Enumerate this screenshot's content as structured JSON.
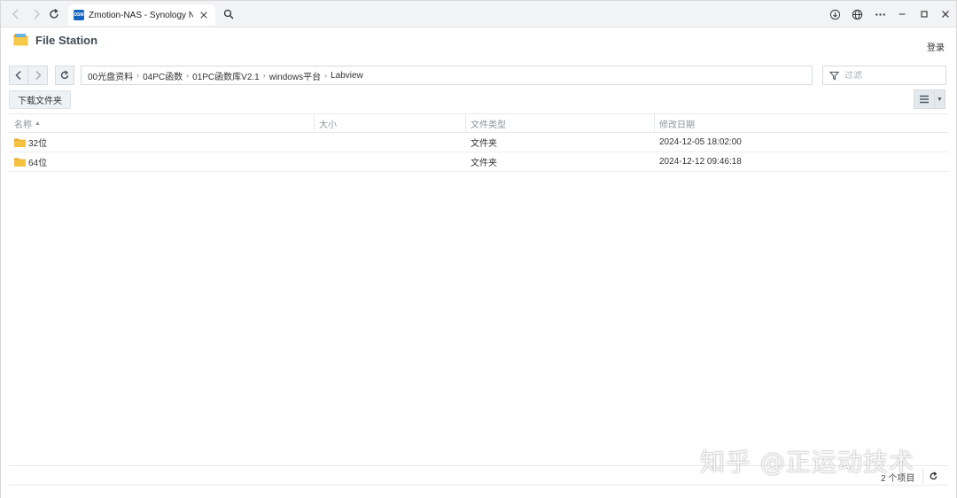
{
  "browser": {
    "tab_title": "Zmotion-NAS - Synology N",
    "favicon_text": "DSM"
  },
  "app": {
    "title": "File Station",
    "login_label": "登录"
  },
  "toolbar": {
    "breadcrumbs": [
      "00光盘资料",
      "04PC函数",
      "01PC函数库V2.1",
      "windows平台",
      "Labview"
    ],
    "filter_placeholder": "过滤",
    "download_label": "下载文件夹"
  },
  "table": {
    "headers": {
      "name": "名称",
      "size": "大小",
      "type": "文件类型",
      "modified": "修改日期"
    },
    "rows": [
      {
        "name": "32位",
        "size": "",
        "type": "文件夹",
        "modified": "2024-12-05 18:02:00"
      },
      {
        "name": "64位",
        "size": "",
        "type": "文件夹",
        "modified": "2024-12-12 09:46:18"
      }
    ]
  },
  "footer": {
    "item_count": "2 个项目"
  },
  "watermark": "知乎 @正运动技术",
  "colors": {
    "folder": "#f5c242",
    "favicon": "#1565c0",
    "toolbar_bg": "#eef2f5"
  }
}
